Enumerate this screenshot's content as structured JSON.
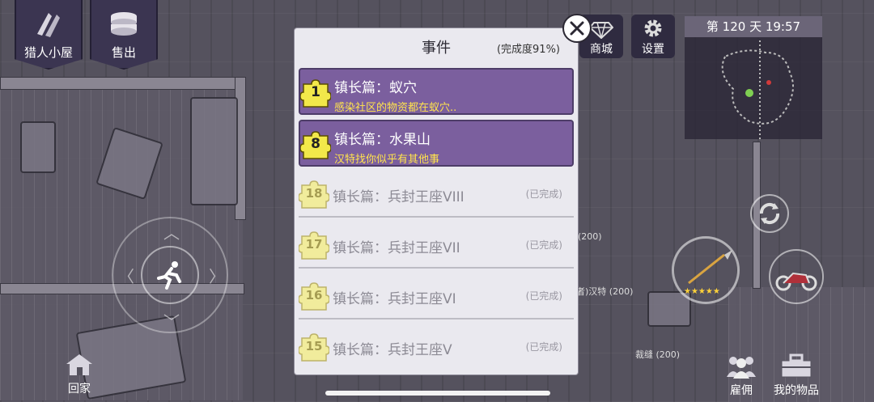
{
  "hud": {
    "hunter_hut": "猎人小屋",
    "sell": "售出",
    "go_home": "回家",
    "shop": "商城",
    "settings": "设置",
    "hire": "雇佣",
    "my_items": "我的物品",
    "day_time": "第 120 天   19:57"
  },
  "world_labels": {
    "hant_tag": "者)汉特 (200)",
    "caiji_tag": "裁缝 (200)",
    "left_tag": "(200)"
  },
  "events": {
    "title": "事件",
    "progress": "(完成度91%)",
    "items": [
      {
        "badge": "1",
        "title": "镇长篇：蚁穴",
        "desc": "感染社区的物资都在蚁穴..",
        "status": ""
      },
      {
        "badge": "8",
        "title": "镇长篇：水果山",
        "desc": "汉特找你似乎有其他事",
        "status": ""
      },
      {
        "badge": "18",
        "title": "镇长篇：兵封王座VIII",
        "desc": "",
        "status": "(已完成)"
      },
      {
        "badge": "17",
        "title": "镇长篇：兵封王座VII",
        "desc": "",
        "status": "(已完成)"
      },
      {
        "badge": "16",
        "title": "镇长篇：兵封王座VI",
        "desc": "",
        "status": "(已完成)"
      },
      {
        "badge": "15",
        "title": "镇长篇：兵封王座V",
        "desc": "",
        "status": "(已完成)"
      }
    ]
  },
  "colors": {
    "active_item": "#7b5f9e",
    "desc_text": "#ffe34d",
    "badge_yellow": "#f2e84a"
  }
}
